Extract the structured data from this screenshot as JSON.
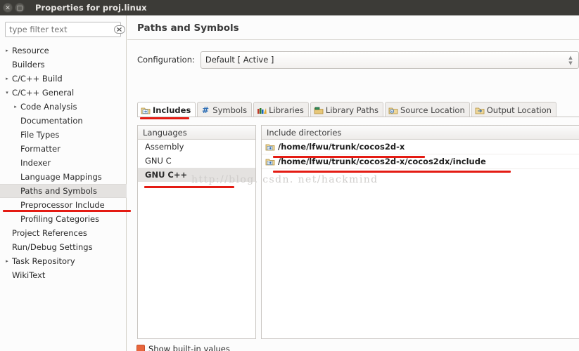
{
  "window": {
    "title": "Properties for proj.linux",
    "close_label": "✕",
    "maximize_label": "□"
  },
  "sidebar": {
    "filter": {
      "placeholder": "type filter text",
      "value": "",
      "clear_icon": "clear-icon"
    },
    "items": [
      {
        "label": "Resource",
        "indent": 0,
        "twisty": "▸",
        "selected": false
      },
      {
        "label": "Builders",
        "indent": 0,
        "twisty": "",
        "selected": false
      },
      {
        "label": "C/C++ Build",
        "indent": 0,
        "twisty": "▸",
        "selected": false
      },
      {
        "label": "C/C++ General",
        "indent": 0,
        "twisty": "▾",
        "selected": false
      },
      {
        "label": "Code Analysis",
        "indent": 1,
        "twisty": "▸",
        "selected": false
      },
      {
        "label": "Documentation",
        "indent": 1,
        "twisty": "",
        "selected": false
      },
      {
        "label": "File Types",
        "indent": 1,
        "twisty": "",
        "selected": false
      },
      {
        "label": "Formatter",
        "indent": 1,
        "twisty": "",
        "selected": false
      },
      {
        "label": "Indexer",
        "indent": 1,
        "twisty": "",
        "selected": false
      },
      {
        "label": "Language Mappings",
        "indent": 1,
        "twisty": "",
        "selected": false
      },
      {
        "label": "Paths and Symbols",
        "indent": 1,
        "twisty": "",
        "selected": true
      },
      {
        "label": "Preprocessor Include",
        "indent": 1,
        "twisty": "",
        "selected": false
      },
      {
        "label": "Profiling Categories",
        "indent": 1,
        "twisty": "",
        "selected": false
      },
      {
        "label": "Project References",
        "indent": 0,
        "twisty": "",
        "selected": false
      },
      {
        "label": "Run/Debug Settings",
        "indent": 0,
        "twisty": "",
        "selected": false
      },
      {
        "label": "Task Repository",
        "indent": 0,
        "twisty": "▸",
        "selected": false
      },
      {
        "label": "WikiText",
        "indent": 0,
        "twisty": "",
        "selected": false
      }
    ]
  },
  "main": {
    "page_title": "Paths and Symbols",
    "configuration": {
      "label": "Configuration:",
      "value": "Default  [ Active ]",
      "spinner_up": "▲",
      "spinner_down": "▼"
    },
    "tabs": [
      {
        "label": "Includes",
        "icon": "includes-icon",
        "active": true
      },
      {
        "label": "Symbols",
        "icon": "hash-icon",
        "active": false
      },
      {
        "label": "Libraries",
        "icon": "books-icon",
        "active": false
      },
      {
        "label": "Library Paths",
        "icon": "folder-green-icon",
        "active": false
      },
      {
        "label": "Source Location",
        "icon": "folder-source-icon",
        "active": false
      },
      {
        "label": "Output Location",
        "icon": "folder-output-icon",
        "active": false
      }
    ],
    "languages": {
      "header": "Languages",
      "rows": [
        {
          "label": "Assembly",
          "selected": false
        },
        {
          "label": "GNU C",
          "selected": false
        },
        {
          "label": "GNU C++",
          "selected": true
        }
      ]
    },
    "includes": {
      "header": "Include directories",
      "rows": [
        {
          "path": "/home/lfwu/trunk/cocos2d-x"
        },
        {
          "path": "/home/lfwu/trunk/cocos2d-x/cocos2dx/include"
        }
      ]
    },
    "bottom_checkbox": {
      "label": "Show built-in values",
      "checked": true
    }
  },
  "annotations": {
    "watermark": "http://blog. csdn. net/hackmind",
    "marker_color": "#e41b13"
  }
}
